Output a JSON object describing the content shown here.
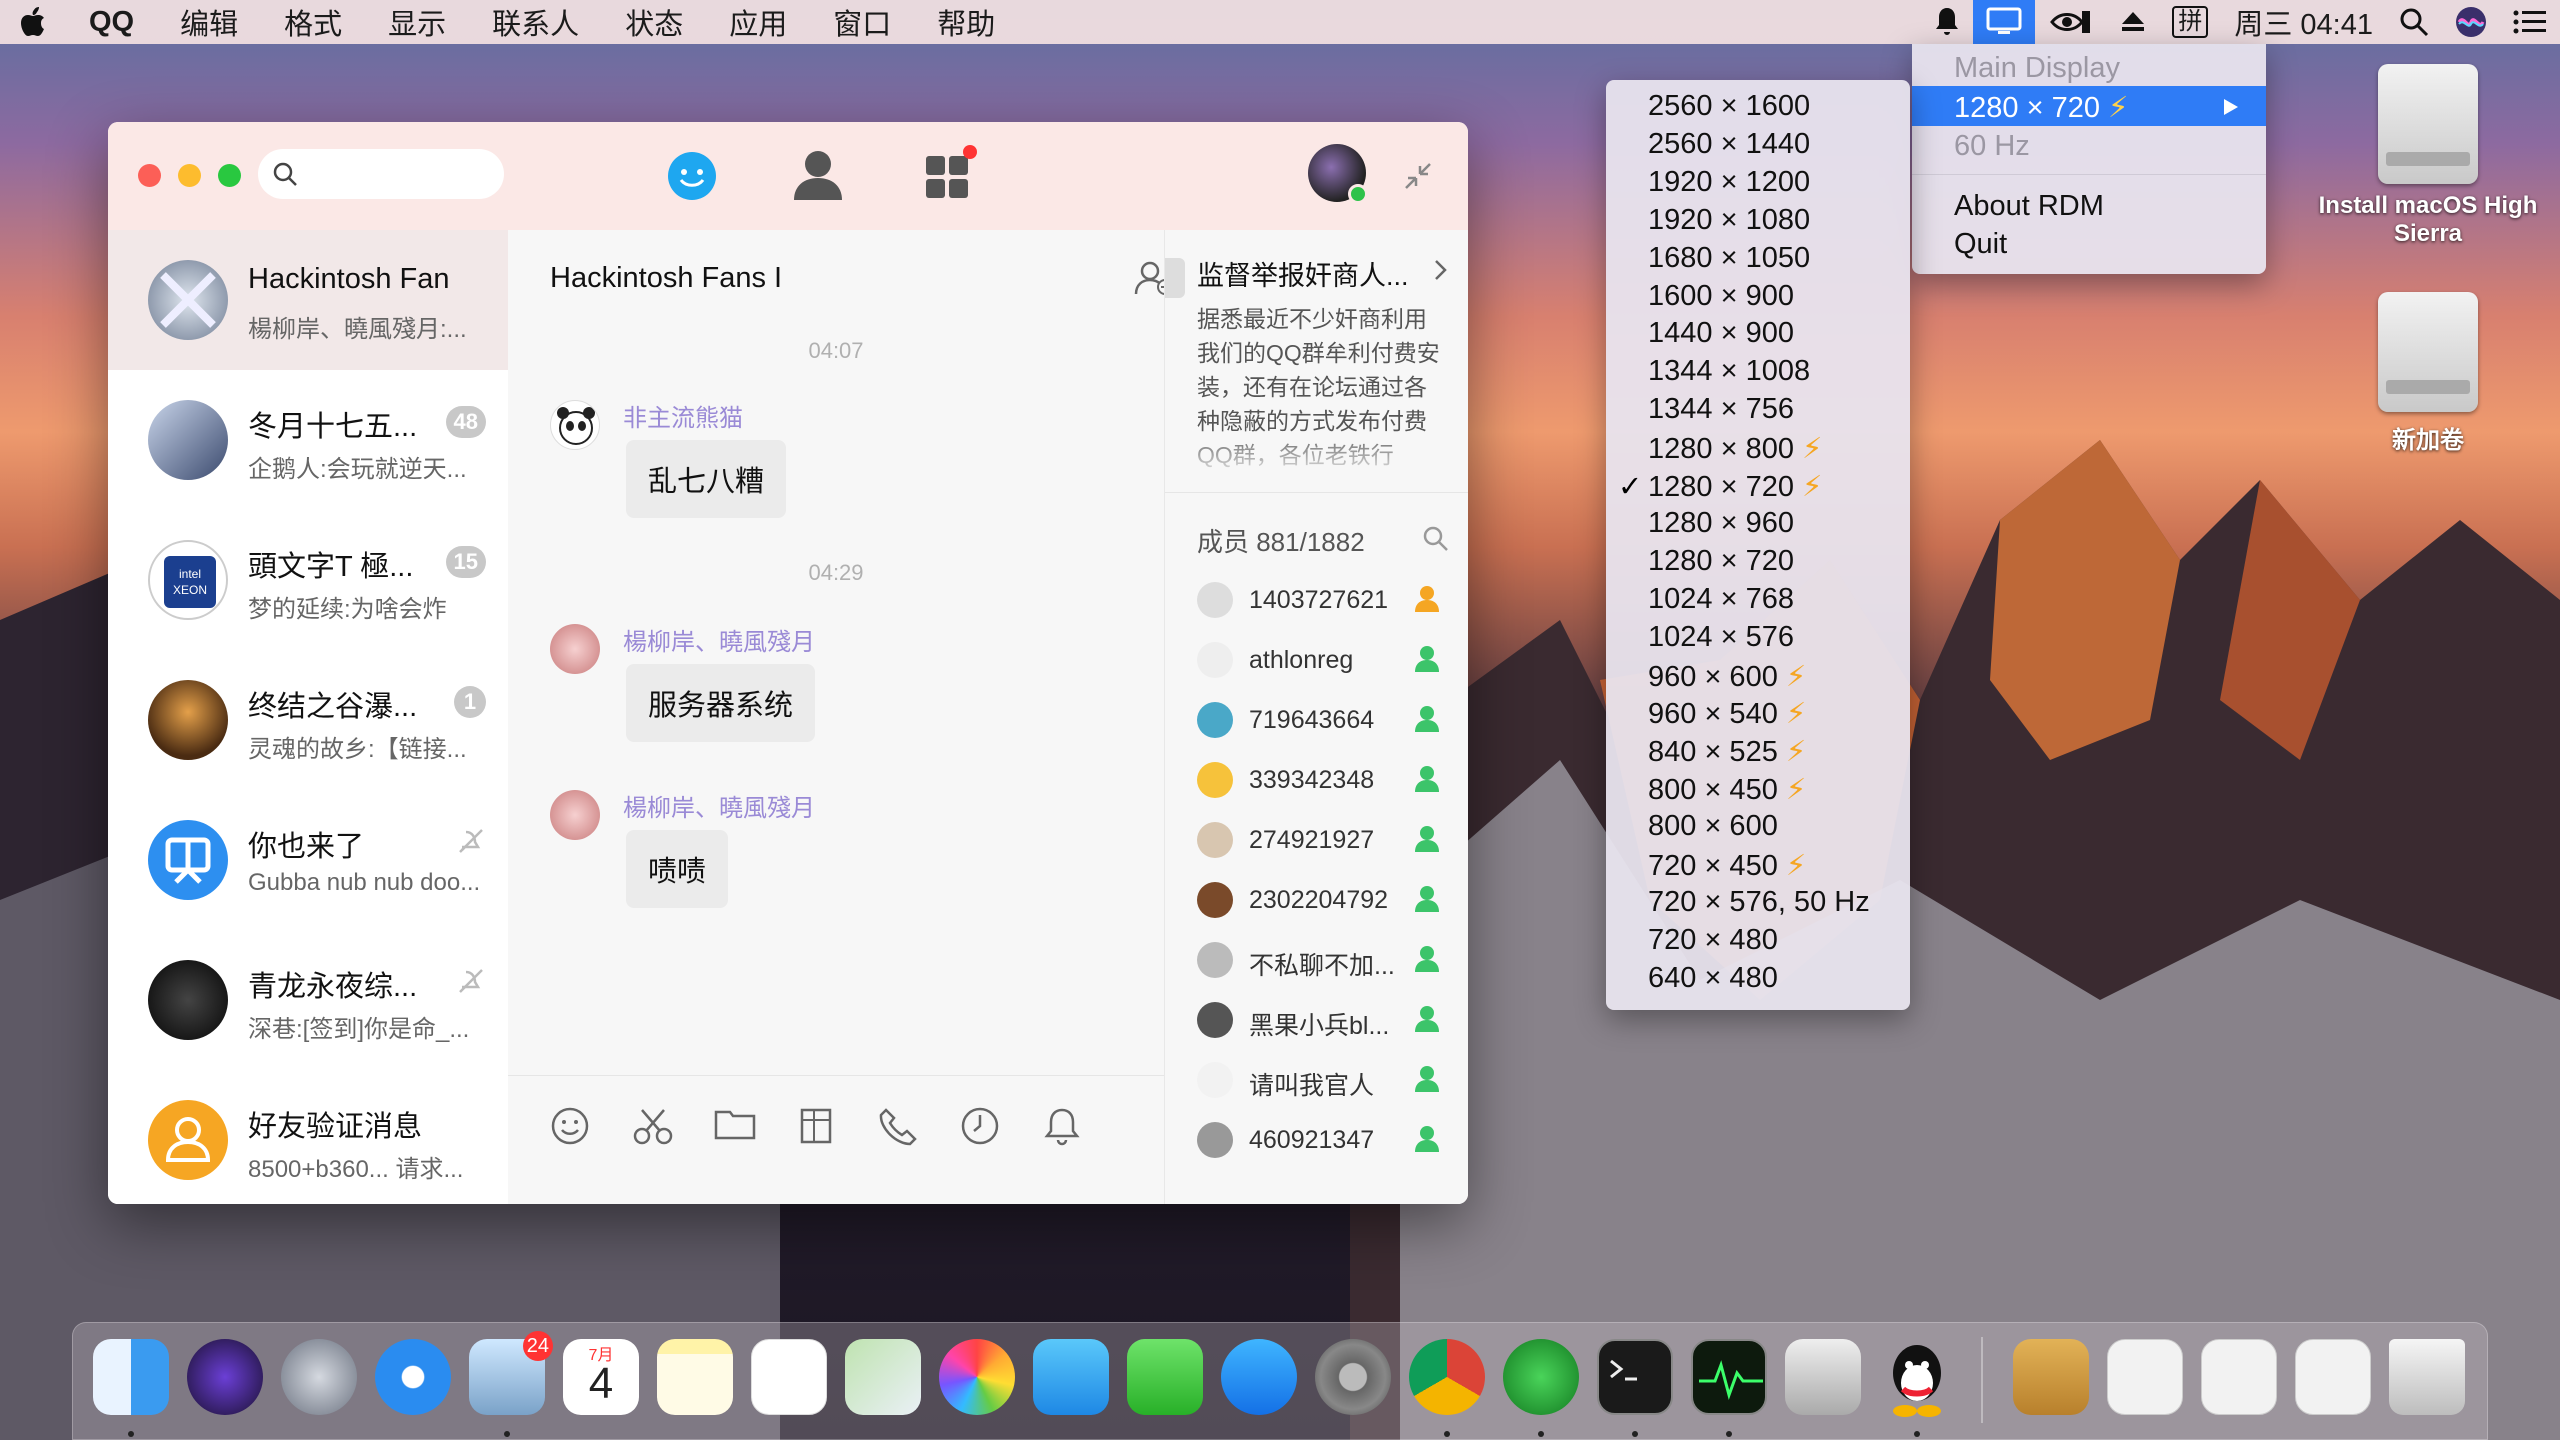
{
  "menubar": {
    "app": "QQ",
    "items": [
      "编辑",
      "格式",
      "显示",
      "联系人",
      "状态",
      "应用",
      "窗口",
      "帮助"
    ],
    "ime": "拼",
    "clock": "周三 04:41"
  },
  "qq": {
    "search_placeholder": "",
    "conversations": [
      {
        "name": "Hackintosh Fans I",
        "msg": "楊柳岸、曉風殘月:...",
        "badge": ""
      },
      {
        "name": "冬月十七五...",
        "msg": "企鹅人:会玩就逆天...",
        "badge": "48"
      },
      {
        "name": "頭文字T 極...",
        "msg": "梦的延续:为啥会炸",
        "badge": "15"
      },
      {
        "name": "终结之谷瀑...",
        "msg": "灵魂的故乡:【链接...",
        "badge": "1"
      },
      {
        "name": "你也来了",
        "msg": "Gubba nub nub doo...",
        "badge": ""
      },
      {
        "name": "青龙永夜综...",
        "msg": "深巷:[签到]你是命_...",
        "badge": ""
      },
      {
        "name": "好友验证消息",
        "msg": "8500+b360... 请求...",
        "badge": ""
      }
    ],
    "chat": {
      "title": "Hackintosh Fans I",
      "messages": [
        {
          "time": "04:07",
          "sender": "非主流熊猫",
          "text": "乱七八糟"
        },
        {
          "time": "04:29",
          "sender": "楊柳岸、曉風殘月",
          "text": "服务器系统"
        },
        {
          "time": "",
          "sender": "楊柳岸、曉風殘月",
          "text": "啧啧"
        }
      ]
    },
    "side": {
      "announcement_title": "监督举报奸商人...",
      "announcement_body": "据悉最近不少奸商利用我们的QQ群牟利付费安装，还有在论坛通过各种隐蔽的方式发布付费QQ群，各位老铁行",
      "members_label": "成员 881/1882",
      "members": [
        "1403727621",
        "athlonreg",
        "719643664",
        "339342348",
        "274921927",
        "2302204792",
        "不私聊不加...",
        "黑果小兵bl...",
        "请叫我官人",
        "460921347"
      ]
    }
  },
  "resolutions": {
    "items": [
      {
        "label": "2560 × 1600",
        "bolt": false
      },
      {
        "label": "2560 × 1440",
        "bolt": false
      },
      {
        "label": "1920 × 1200",
        "bolt": false
      },
      {
        "label": "1920 × 1080",
        "bolt": false
      },
      {
        "label": "1680 × 1050",
        "bolt": false
      },
      {
        "label": "1600 × 900",
        "bolt": false
      },
      {
        "label": "1440 × 900",
        "bolt": false
      },
      {
        "label": "1344 × 1008",
        "bolt": false
      },
      {
        "label": "1344 × 756",
        "bolt": false
      },
      {
        "label": "1280 × 800",
        "bolt": true
      },
      {
        "label": "1280 × 720",
        "bolt": true,
        "checked": true
      },
      {
        "label": "1280 × 960",
        "bolt": false
      },
      {
        "label": "1280 × 720",
        "bolt": false
      },
      {
        "label": "1024 × 768",
        "bolt": false
      },
      {
        "label": "1024 × 576",
        "bolt": false
      },
      {
        "label": "960 × 600",
        "bolt": true
      },
      {
        "label": "960 × 540",
        "bolt": true
      },
      {
        "label": "840 × 525",
        "bolt": true
      },
      {
        "label": "800 × 450",
        "bolt": true
      },
      {
        "label": "800 × 600",
        "bolt": false
      },
      {
        "label": "720 × 450",
        "bolt": true
      },
      {
        "label": "720 × 576, 50 Hz",
        "bolt": false
      },
      {
        "label": "720 × 480",
        "bolt": false
      },
      {
        "label": "640 × 480",
        "bolt": false
      }
    ],
    "bolt_char": "⚡",
    "check_char": "✓"
  },
  "rdm_menu": {
    "display": "Main Display",
    "current": "1280 × 720",
    "refresh": "60 Hz",
    "about": "About RDM",
    "quit": "Quit"
  },
  "desktop": {
    "install_label": "Install macOS High Sierra",
    "volume_label": "新加卷"
  },
  "dock": {
    "calendar_month": "7月",
    "calendar_day": "4",
    "mail_badge": "24"
  },
  "colors": {
    "accent": "#2f7cf6",
    "qq_top": "#fbe8e6",
    "badge": "#c8c8c8",
    "bolt": "#f5a623"
  }
}
